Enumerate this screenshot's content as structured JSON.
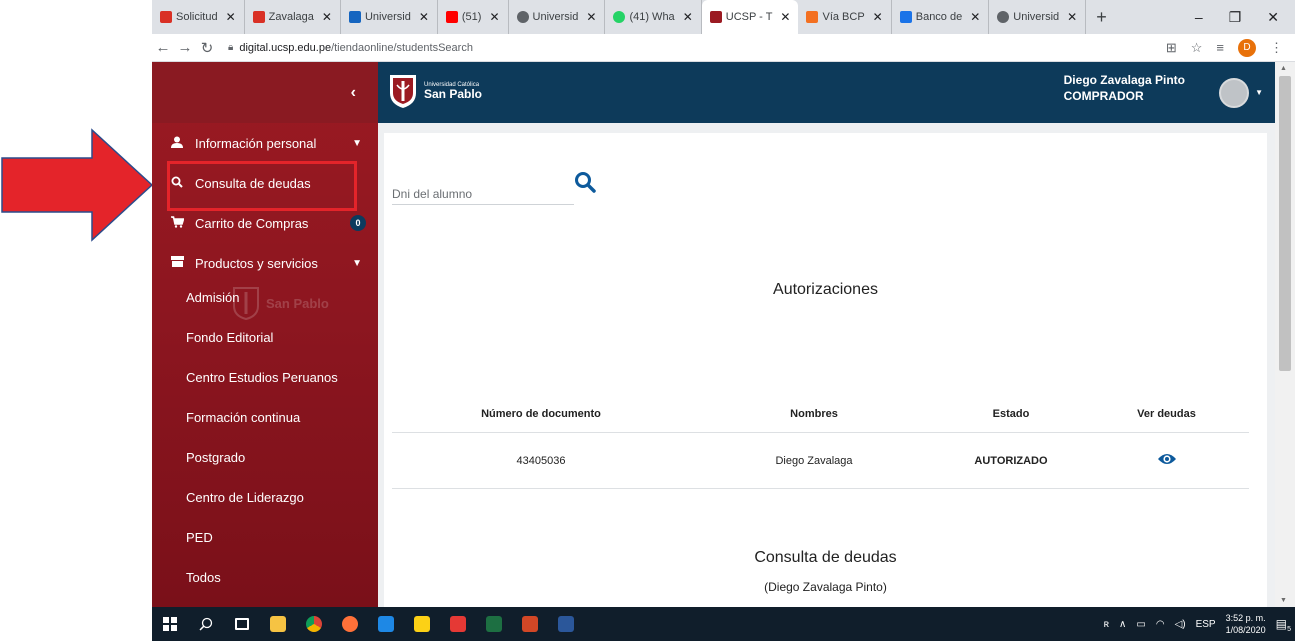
{
  "browser": {
    "tabs": [
      {
        "label": "Solicitud",
        "fav_color": "#d93025",
        "fav_icon": "gmail-icon"
      },
      {
        "label": "Zavalaga",
        "fav_color": "#d93025",
        "fav_icon": "gmail-icon"
      },
      {
        "label": "Universid",
        "fav_color": "#1565c0",
        "fav_icon": "app-icon"
      },
      {
        "label": "(51)",
        "fav_color": "#ff0000",
        "fav_icon": "youtube-icon"
      },
      {
        "label": "Universid",
        "fav_color": "#5f6368",
        "fav_icon": "globe-icon"
      },
      {
        "label": "(41) Wha",
        "fav_color": "#25d366",
        "fav_icon": "whatsapp-icon"
      },
      {
        "label": "UCSP - T",
        "fav_color": "#9b1a22",
        "fav_icon": "ucsp-icon"
      },
      {
        "label": "Vía BCP",
        "fav_color": "#f37021",
        "fav_icon": "bcp-icon"
      },
      {
        "label": "Banco de",
        "fav_color": "#1a73e8",
        "fav_icon": "bank-icon"
      },
      {
        "label": "Universid",
        "fav_color": "#5f6368",
        "fav_icon": "globe-icon"
      }
    ],
    "new_tab": "+",
    "url_host": "digital.ucsp.edu.pe",
    "url_path": "/tiendaonline/studentsSearch",
    "profile_initial": "D"
  },
  "sidebar": {
    "collapse_icon": "‹",
    "items": [
      {
        "label": "Información personal",
        "icon": "user-icon"
      },
      {
        "label": "Consulta de deudas",
        "icon": "search-icon"
      },
      {
        "label": "Carrito de Compras",
        "icon": "cart-icon",
        "badge": "0"
      },
      {
        "label": "Productos y servicios",
        "icon": "store-icon"
      }
    ],
    "subitems": [
      "Admisión",
      "Fondo Editorial",
      "Centro Estudios Peruanos",
      "Formación continua",
      "Postgrado",
      "Centro de Liderazgo",
      "PED",
      "Todos"
    ],
    "logo_ghost_text": "San Pablo"
  },
  "header": {
    "brand_small": "Universidad Católica",
    "brand_big": "San Pablo",
    "user_name": "Diego Zavalaga Pinto",
    "user_role": "COMPRADOR"
  },
  "main": {
    "search_placeholder": "Dni del alumno",
    "authorizations_title": "Autorizaciones",
    "table_headers": [
      "Número de documento",
      "Nombres",
      "Estado",
      "Ver deudas"
    ],
    "rows": [
      {
        "document": "43405036",
        "name": "Diego Zavalaga",
        "status": "AUTORIZADO"
      }
    ],
    "debts_title": "Consulta de deudas",
    "debts_subtitle": "(Diego Zavalaga Pinto)"
  },
  "taskbar": {
    "lang": "ESP",
    "time": "3:52 p. m.",
    "date": "1/08/2020",
    "notifications": "5"
  },
  "colors": {
    "sidebar": "#8d1620",
    "header": "#0d3a5a",
    "accent": "#0d5a9c",
    "annotation": "#e4242a"
  }
}
